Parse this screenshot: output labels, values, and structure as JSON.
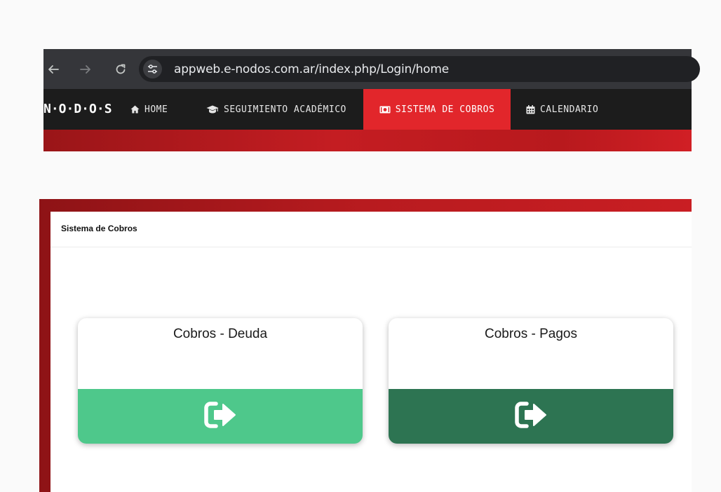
{
  "browser": {
    "url": "appweb.e-nodos.com.ar/index.php/Login/home",
    "icons": [
      "back-arrow-icon",
      "forward-arrow-icon",
      "reload-icon",
      "site-settings-icon"
    ]
  },
  "navbar": {
    "brand": "N·O·D·O·S",
    "items": [
      {
        "label": "HOME",
        "icon": "home-icon"
      },
      {
        "label": "SEGUIMIENTO ACADÉMICO",
        "icon": "graduation-cap-icon"
      },
      {
        "label": "SISTEMA DE COBROS",
        "icon": "money-icon",
        "active": true
      },
      {
        "label": "CALENDARIO",
        "icon": "calendar-icon"
      }
    ],
    "colors": {
      "bar": "#1c1c1c",
      "active": "#e2262b",
      "band": "#c41d22"
    }
  },
  "panel": {
    "title": "Sistema de Cobros",
    "tiles": [
      {
        "label": "Cobros - Deuda",
        "icon": "sign-out-arrow-icon",
        "color": "#4ec88b"
      },
      {
        "label": "Cobros - Pagos",
        "icon": "sign-out-arrow-icon",
        "color": "#2d7452"
      }
    ]
  }
}
